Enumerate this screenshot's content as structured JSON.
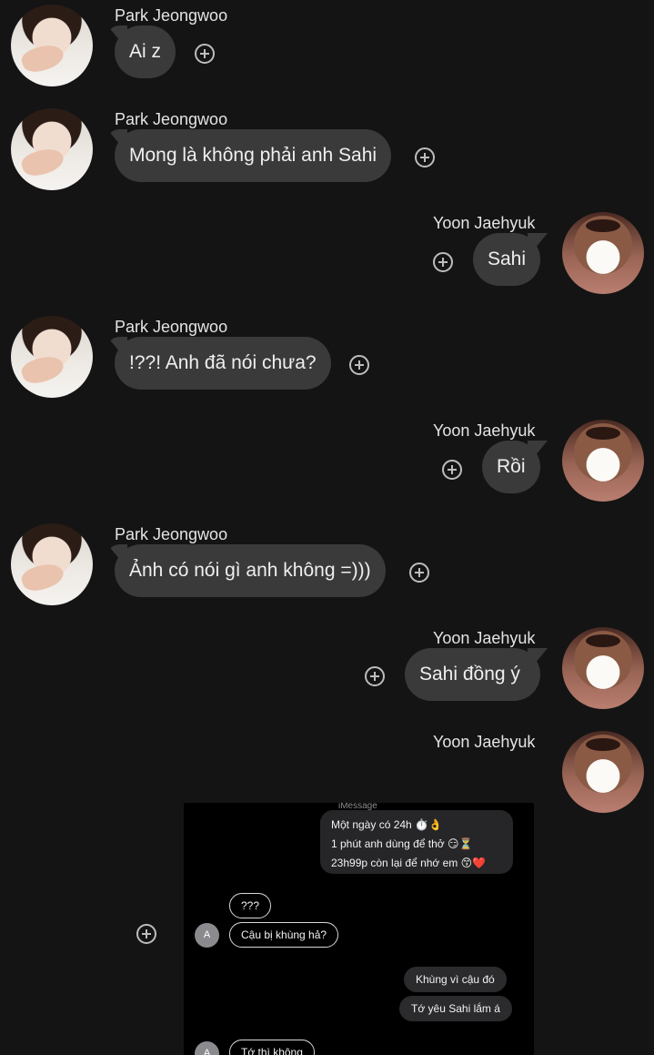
{
  "messages": [
    {
      "sender": "Park Jeongwoo",
      "text": "Ai z"
    },
    {
      "sender": "Park Jeongwoo",
      "text": "Mong là không phải anh Sahi"
    },
    {
      "sender": "Yoon Jaehyuk",
      "text": "Sahi"
    },
    {
      "sender": "Park Jeongwoo",
      "text": "!??! Anh đã nói chưa?"
    },
    {
      "sender": "Yoon Jaehyuk",
      "text": "Rồi"
    },
    {
      "sender": "Park Jeongwoo",
      "text": "Ảnh có nói gì anh không =)))"
    },
    {
      "sender": "Yoon Jaehyuk",
      "text": "Sahi đồng ý"
    },
    {
      "sender": "Yoon Jaehyuk",
      "text": ""
    }
  ],
  "screenshot": {
    "label": "iMessage",
    "lines": [
      "Một ngày có 24h ⏱️👌",
      "1 phút anh dùng để thở 😏⏳",
      "23h99p còn lại để nhớ em 😙❤️"
    ],
    "replies": [
      "???",
      "Cậu bị khùng hả?",
      "Khùng vì cậu đó",
      "Tớ yêu Sahi lắm á",
      "Tớ thì không"
    ],
    "avatar_letter": "A"
  },
  "colors": {
    "background": "#141414",
    "bubble": "#3a3a3a",
    "text": "#efefef"
  },
  "icons": {
    "react": "plus-circle-icon"
  }
}
